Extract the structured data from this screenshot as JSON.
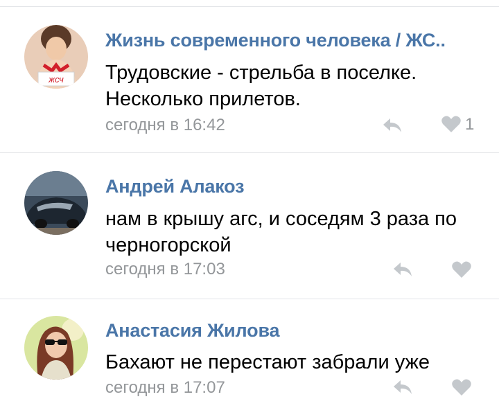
{
  "comments": [
    {
      "author": "Жизнь современного человека / ЖС..",
      "text": "Трудовские - стрельба в поселке. Несколько прилетов.",
      "time": "сегодня в 16:42",
      "likes": "1",
      "avatar_label": "жсч"
    },
    {
      "author": "Андрей Алакоз",
      "text": "нам в крышу агс, и соседям 3 раза по черногорской",
      "time": "сегодня в 17:03"
    },
    {
      "author": "Анастасия Жилова",
      "text": "Бахают не перестают забрали уже",
      "time": "сегодня в 17:07"
    }
  ],
  "icons": {
    "reply": "reply-arrow-icon",
    "like": "heart-icon"
  },
  "colors": {
    "author": "#4a76a8",
    "meta": "#939699",
    "icon": "#c4c8cc",
    "divider": "#e3e5e8"
  }
}
